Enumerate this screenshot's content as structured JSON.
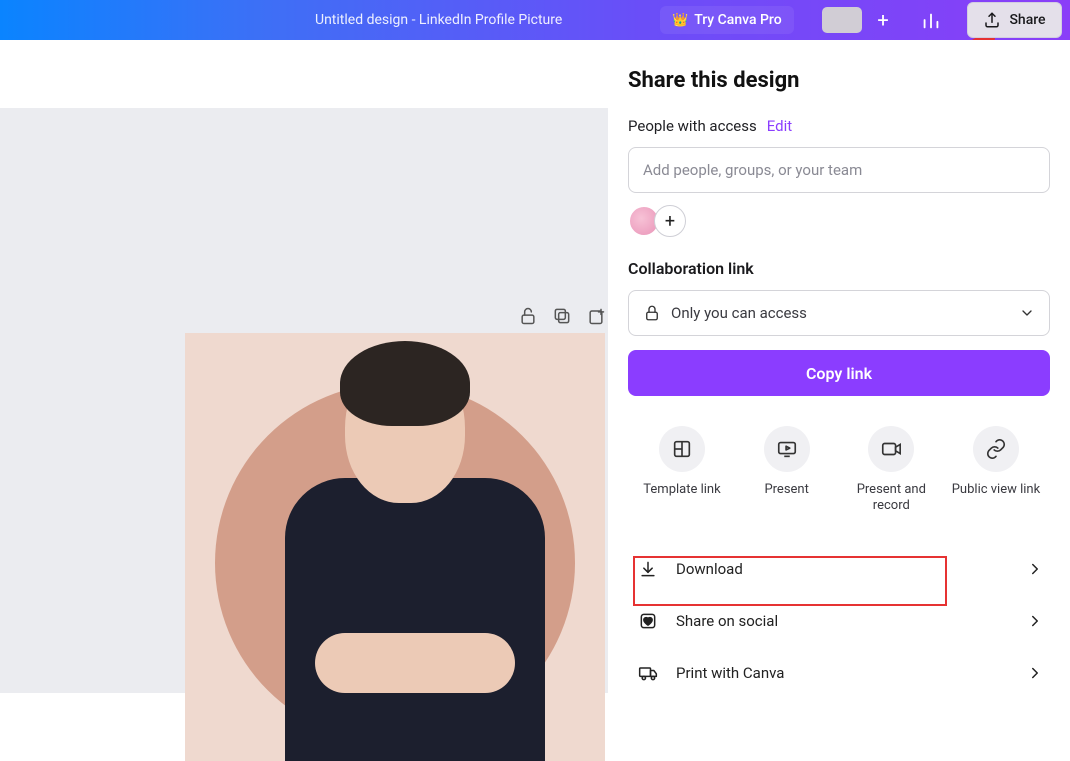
{
  "header": {
    "doc_title": "Untitled design - LinkedIn Profile Picture",
    "try_pro": "Try Canva Pro",
    "share": "Share"
  },
  "panel": {
    "title": "Share this design",
    "access_label": "People with access",
    "edit": "Edit",
    "people_placeholder": "Add people, groups, or your team",
    "collab_title": "Collaboration link",
    "access_select": "Only you can access",
    "copy_link": "Copy link",
    "actions": {
      "template": "Template link",
      "present": "Present",
      "present_record": "Present and record",
      "public": "Public view link"
    },
    "list": {
      "download": "Download",
      "share_social": "Share on social",
      "print_canva": "Print with Canva"
    }
  }
}
